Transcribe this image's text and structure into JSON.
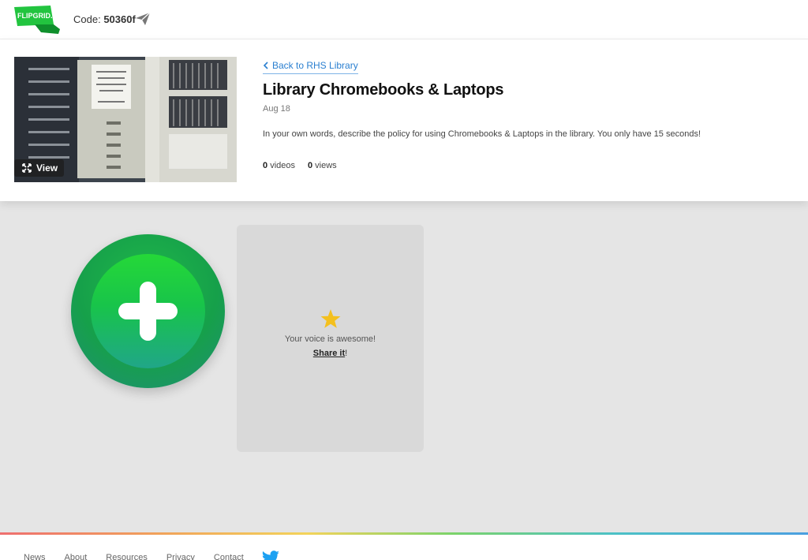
{
  "header": {
    "logo_text": "FLIPGRID.",
    "code_label": "Code:",
    "code_value": "50360f",
    "logo_color": "#22c43f",
    "icons": [
      "flipgrid-logo",
      "send-icon"
    ]
  },
  "topic": {
    "back_link": "Back to RHS Library",
    "title": "Library Chromebooks & Laptops",
    "date": "Aug 18",
    "prompt": "In your own words, describe the policy for using Chromebooks & Laptops in the library. You only have 15 seconds!",
    "videos_count": "0",
    "videos_label": "videos",
    "views_count": "0",
    "views_label": "views",
    "view_button": "View",
    "link_color": "#2a7fd0"
  },
  "main": {
    "add_button_icon": "plus-icon",
    "card": {
      "icon": "star-icon",
      "message": "Your voice is awesome!",
      "share_label": "Share it",
      "share_suffix": "!",
      "star_color": "#f4c01e"
    }
  },
  "footer": {
    "links": [
      "News",
      "About",
      "Resources",
      "Privacy",
      "Contact"
    ],
    "social_icon": "twitter-icon",
    "twitter_color": "#1da1f2"
  }
}
